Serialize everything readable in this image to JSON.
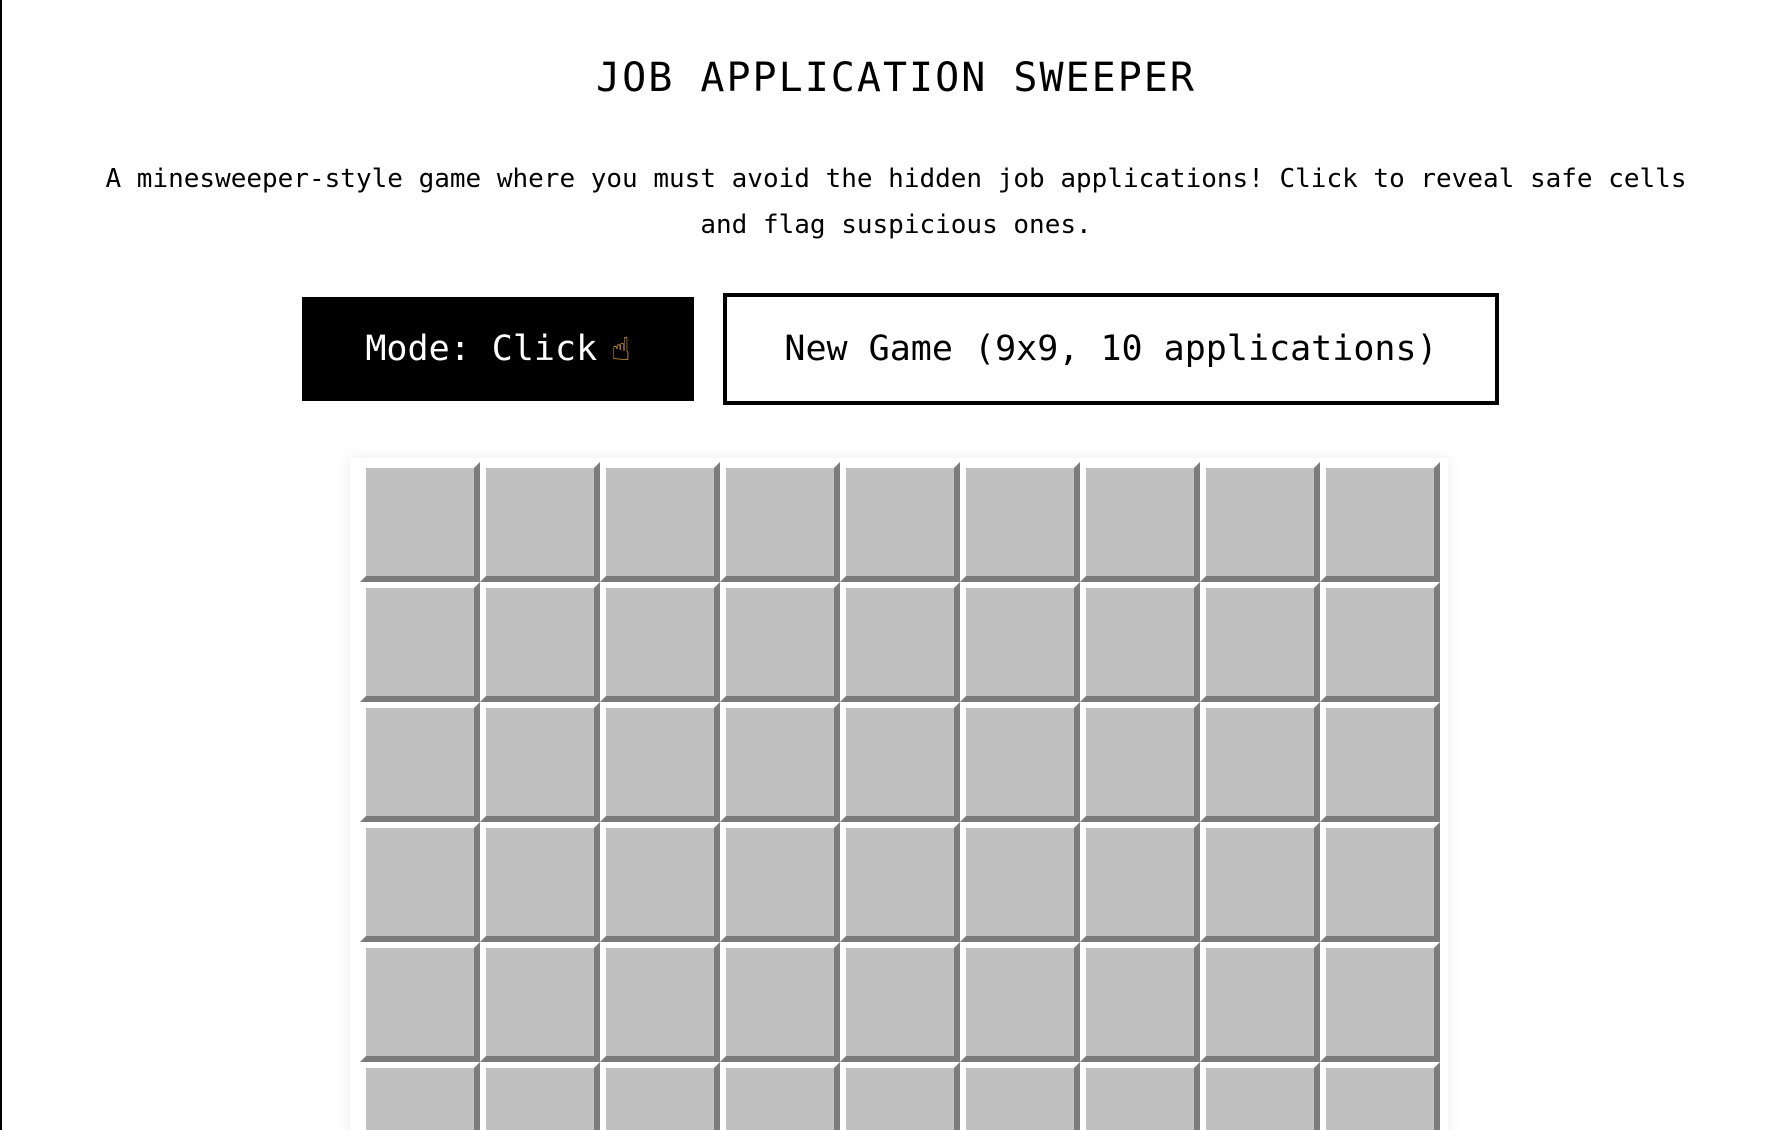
{
  "game": {
    "title": "JOB APPLICATION SWEEPER",
    "description": "A minesweeper-style game where you must avoid the hidden job applications! Click to reveal safe cells and flag suspicious ones."
  },
  "controls": {
    "mode_label": "Mode: Click",
    "mode_icon": "pointing-hand-icon",
    "new_game_label": "New Game (9x9, 10 applications)"
  },
  "board": {
    "rows": 9,
    "cols": 9,
    "visible_rows": 6,
    "cell_state": "unrevealed",
    "cell_color": "#c0c0c0"
  }
}
